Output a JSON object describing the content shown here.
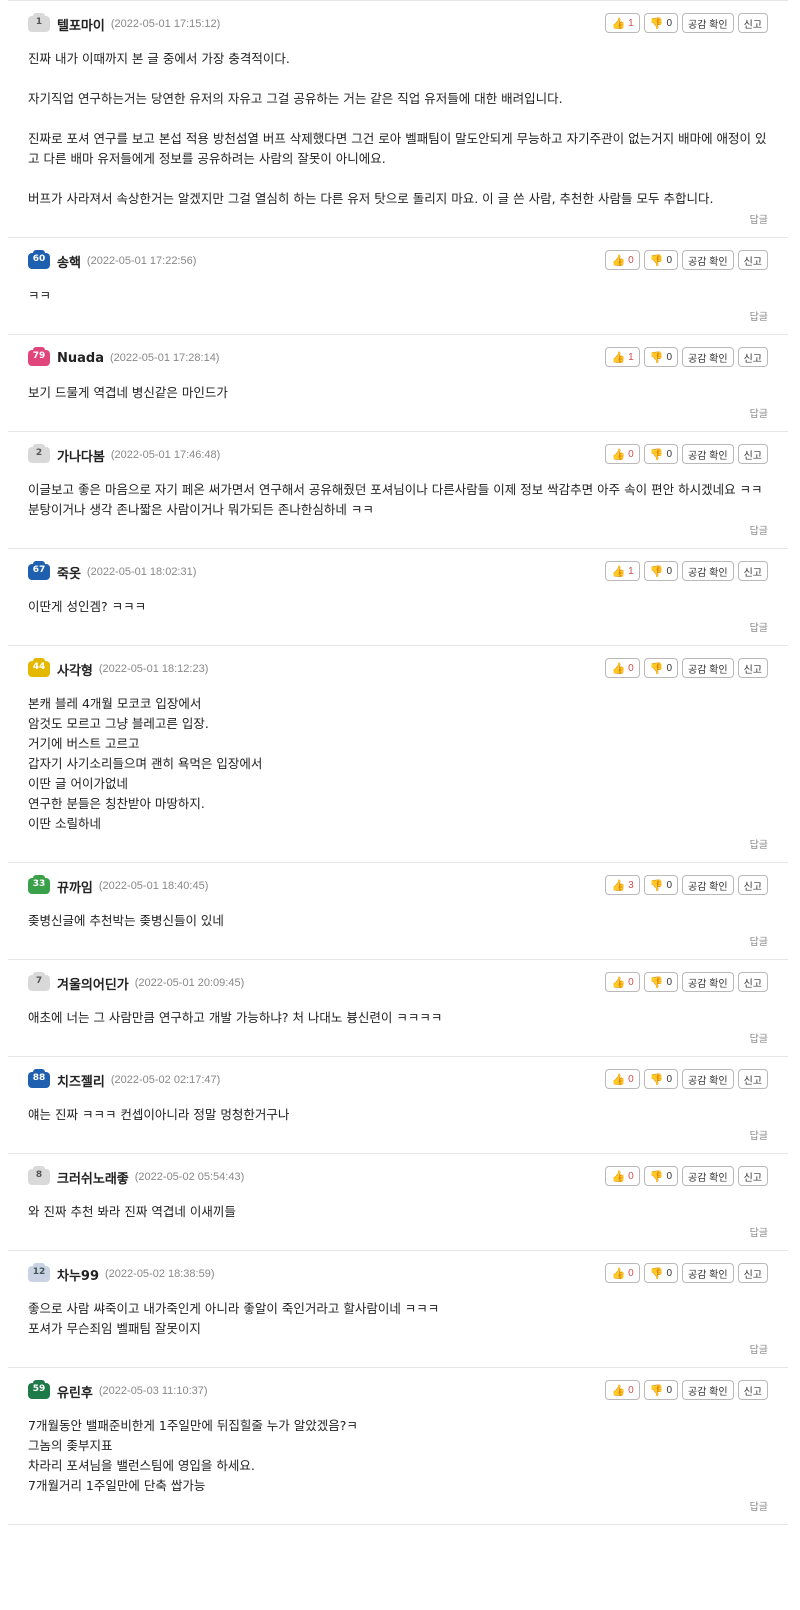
{
  "reply_label": "답글",
  "buttons": {
    "empathy": "공감 확인",
    "report": "신고"
  },
  "colors": {
    "up": "#d34c4c",
    "down": "#4a7bd1",
    "border": "#b9b9b9"
  },
  "comments": [
    {
      "level": "1",
      "badge_color": "#d9d9d9",
      "badge_text_color": "#555",
      "name": "텔포마이",
      "date": "(2022-05-01 17:15:12)",
      "up": "1",
      "down": "0",
      "body_lines": 22,
      "text": "진짜 내가 이때까지 본 글 중에서 가장 충격적이다.\n\n자기직업 연구하는거는 당연한 유저의 자유고 그걸 공유하는 거는 같은 직업 유저들에 대한 배려입니다.\n\n진짜로 포셔 연구를 보고 본섭 적용 방천섬열 버프 삭제했다면 그건 로아 벨패팀이 말도안되게 무능하고 자기주관이 없는거지 배마에 애정이 있고 다른 배마 유저들에게 정보를 공유하려는 사람의 잘못이 아니에요.\n\n버프가 사라져서 속상한거는 알겠지만 그걸 열심히 하는 다른 유저 탓으로 돌리지 마요. 이 글 쓴 사람, 추천한 사람들 모두 추합니다."
    },
    {
      "level": "60",
      "badge_color": "#1f5fb0",
      "badge_text_color": "#fff",
      "name": "송핵",
      "date": "(2022-05-01 17:22:56)",
      "up": "0",
      "down": "0",
      "text": "ㅋㅋ"
    },
    {
      "level": "79",
      "badge_color": "#e0457b",
      "badge_text_color": "#fff",
      "name": "Nuada",
      "date": "(2022-05-01 17:28:14)",
      "up": "1",
      "down": "0",
      "text": "보기 드물게 역겹네 병신같은 마인드가"
    },
    {
      "level": "2",
      "badge_color": "#d9d9d9",
      "badge_text_color": "#555",
      "name": "가나다봄",
      "date": "(2022-05-01 17:46:48)",
      "up": "0",
      "down": "0",
      "text": "이글보고 좋은 마음으로 자기 페온 써가면서 연구해서 공유해줬던 포셔님이나 다른사람들 이제 정보 싹감추면 아주 속이 편안 하시겠네요 ㅋㅋ 분탕이거나 생각 존나짧은 사람이거나 뭐가되든 존나한심하네 ㅋㅋ"
    },
    {
      "level": "67",
      "badge_color": "#1f5fb0",
      "badge_text_color": "#fff",
      "name": "죽옷",
      "date": "(2022-05-01 18:02:31)",
      "up": "1",
      "down": "0",
      "text": "이딴게 성인겜? ㅋㅋㅋ"
    },
    {
      "level": "44",
      "badge_color": "#e5b800",
      "badge_text_color": "#fff",
      "name": "사각형",
      "date": "(2022-05-01 18:12:23)",
      "up": "0",
      "down": "0",
      "text": "본캐 블레 4개월 모코코 입장에서\n암것도 모르고 그냥 블레고른 입장.\n거기에 버스트 고르고\n갑자기 사기소리들으며 괜히 욕먹은 입장에서\n이딴 글 어이가없네\n연구한 분들은 칭찬받아 마땅하지.\n이딴 소릴하네"
    },
    {
      "level": "33",
      "badge_color": "#3aa04a",
      "badge_text_color": "#fff",
      "name": "뀨까임",
      "date": "(2022-05-01 18:40:45)",
      "up": "3",
      "down": "0",
      "text": "좆병신글에 추천박는 좆병신들이 있네"
    },
    {
      "level": "7",
      "badge_color": "#d9d9d9",
      "badge_text_color": "#555",
      "name": "겨울의어딘가",
      "date": "(2022-05-01 20:09:45)",
      "up": "0",
      "down": "0",
      "text": "애초에 너는 그 사람만큼 연구하고 개발 가능하냐? 처 나대노 븅신련이 ㅋㅋㅋㅋ"
    },
    {
      "level": "88",
      "badge_color": "#1f5fb0",
      "badge_text_color": "#fff",
      "name": "치즈젤리",
      "date": "(2022-05-02 02:17:47)",
      "up": "0",
      "down": "0",
      "text": "얘는 진짜 ㅋㅋㅋ 컨셉이아니라 정말 멍청한거구나"
    },
    {
      "level": "8",
      "badge_color": "#d9d9d9",
      "badge_text_color": "#555",
      "name": "크러쉬노래좋",
      "date": "(2022-05-02 05:54:43)",
      "up": "0",
      "down": "0",
      "text": "와 진짜 추천 봐라 진짜 역겹네 이새끼들"
    },
    {
      "level": "12",
      "badge_color": "#c9d3e3",
      "badge_text_color": "#455",
      "name": "차누99",
      "date": "(2022-05-02 18:38:59)",
      "up": "0",
      "down": "0",
      "text": "좋으로 사람 쌰죽이고 내가죽인게 아니라 좋알이 죽인거라고 할사람이네 ㅋㅋㅋ\n포셔가 무슨죄임 벨패팀 잘못이지"
    },
    {
      "level": "59",
      "badge_color": "#1e7a48",
      "badge_text_color": "#fff",
      "name": "유린후",
      "date": "(2022-05-03 11:10:37)",
      "up": "0",
      "down": "0",
      "text": "7개월동안 밸패준비한게 1주일만에 뒤집힐줄 누가 알았겠음?ㅋ\n그놈의 좆부지표\n차라리 포셔님을 밸런스팀에 영입을 하세요.\n7개월거리 1주일만에 단축 쌉가능"
    }
  ]
}
